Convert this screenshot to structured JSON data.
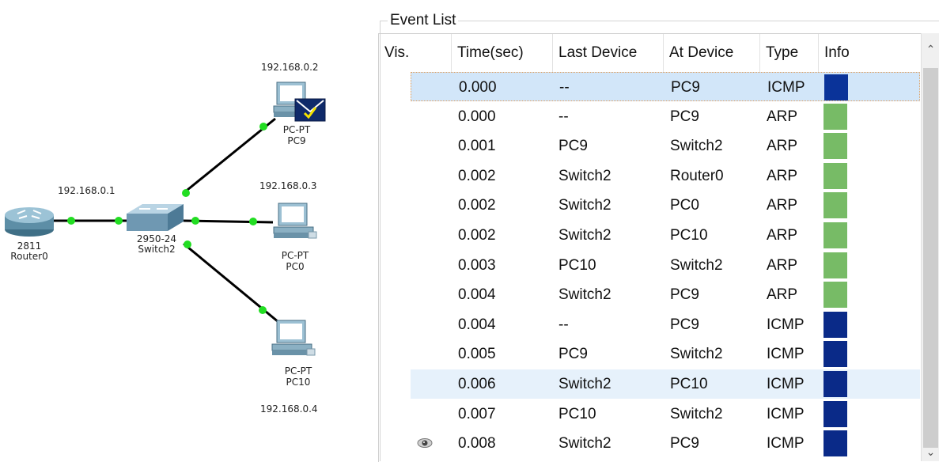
{
  "topology": {
    "router": {
      "model": "2811",
      "name": "Router0",
      "ip": "192.168.0.1"
    },
    "switch": {
      "model": "2950-24",
      "name": "Switch2"
    },
    "pcs": [
      {
        "type": "PC-PT",
        "name": "PC9",
        "ip": "192.168.0.2"
      },
      {
        "type": "PC-PT",
        "name": "PC0",
        "ip": "192.168.0.3"
      },
      {
        "type": "PC-PT",
        "name": "PC10",
        "ip": "192.168.0.4"
      }
    ],
    "link_color": "#000000",
    "port_light_color": "#22dd22"
  },
  "event_list": {
    "title": "Event List",
    "columns": [
      "Vis.",
      "Time(sec)",
      "Last Device",
      "At Device",
      "Type",
      "Info"
    ],
    "rows": [
      {
        "vis": "",
        "time": "0.000",
        "last": "--",
        "at": "PC9",
        "type": "ICMP",
        "info_color": "#0a3399",
        "state": "selected"
      },
      {
        "vis": "",
        "time": "0.000",
        "last": "--",
        "at": "PC9",
        "type": "ARP",
        "info_color": "#77bb66",
        "state": ""
      },
      {
        "vis": "",
        "time": "0.001",
        "last": "PC9",
        "at": "Switch2",
        "type": "ARP",
        "info_color": "#77bb66",
        "state": ""
      },
      {
        "vis": "",
        "time": "0.002",
        "last": "Switch2",
        "at": "Router0",
        "type": "ARP",
        "info_color": "#77bb66",
        "state": ""
      },
      {
        "vis": "",
        "time": "0.002",
        "last": "Switch2",
        "at": "PC0",
        "type": "ARP",
        "info_color": "#77bb66",
        "state": ""
      },
      {
        "vis": "",
        "time": "0.002",
        "last": "Switch2",
        "at": "PC10",
        "type": "ARP",
        "info_color": "#77bb66",
        "state": ""
      },
      {
        "vis": "",
        "time": "0.003",
        "last": "PC10",
        "at": "Switch2",
        "type": "ARP",
        "info_color": "#77bb66",
        "state": ""
      },
      {
        "vis": "",
        "time": "0.004",
        "last": "Switch2",
        "at": "PC9",
        "type": "ARP",
        "info_color": "#77bb66",
        "state": ""
      },
      {
        "vis": "",
        "time": "0.004",
        "last": "--",
        "at": "PC9",
        "type": "ICMP",
        "info_color": "#0a2a88",
        "state": ""
      },
      {
        "vis": "",
        "time": "0.005",
        "last": "PC9",
        "at": "Switch2",
        "type": "ICMP",
        "info_color": "#0a2a88",
        "state": ""
      },
      {
        "vis": "",
        "time": "0.006",
        "last": "Switch2",
        "at": "PC10",
        "type": "ICMP",
        "info_color": "#0a2a88",
        "state": "highlight"
      },
      {
        "vis": "",
        "time": "0.007",
        "last": "PC10",
        "at": "Switch2",
        "type": "ICMP",
        "info_color": "#0a2a88",
        "state": ""
      },
      {
        "vis": "eye-icon",
        "time": "0.008",
        "last": "Switch2",
        "at": "PC9",
        "type": "ICMP",
        "info_color": "#0a2a88",
        "state": ""
      }
    ]
  }
}
